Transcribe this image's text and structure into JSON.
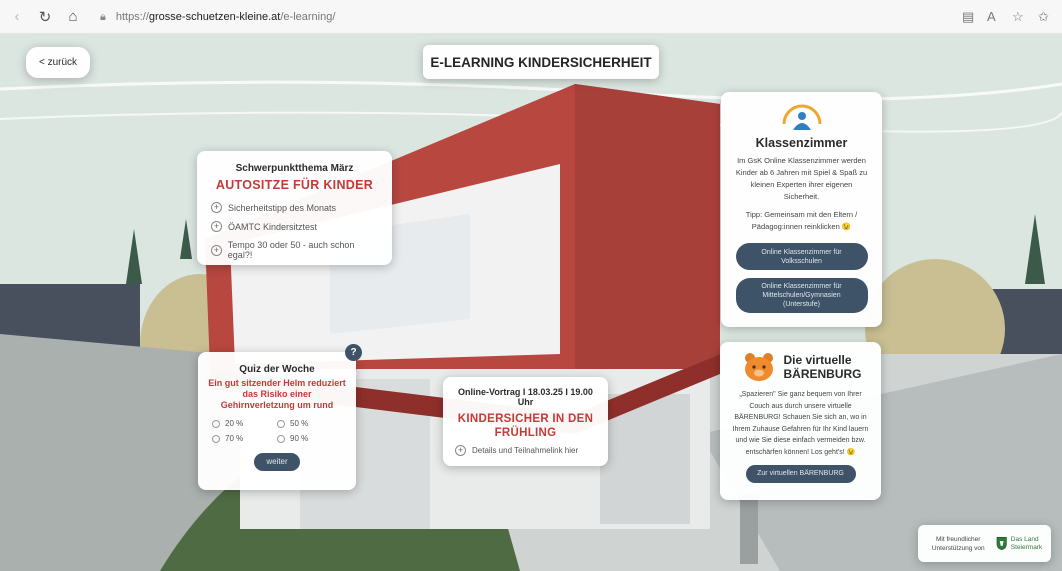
{
  "browser": {
    "url_prefix": "https://",
    "url_domain": "grosse-schuetzen-kleine.at",
    "url_path": "/e-learning/"
  },
  "header": {
    "back_label": "< zurück",
    "title": "E-LEARNING KINDERSICHERHEIT"
  },
  "focus_card": {
    "heading": "Schwerpunktthema März",
    "title": "AUTOSITZE FÜR KINDER",
    "links": [
      "Sicherheitstipp des Monats",
      "ÖAMTC Kindersitztest",
      "Tempo 30 oder 50 - auch schon egal?!"
    ]
  },
  "quiz_card": {
    "badge": "?",
    "heading": "Quiz der Woche",
    "question": "Ein gut sitzender Helm reduziert das Risiko einer Gehirnverletzung um rund",
    "options": [
      "20 %",
      "50 %",
      "70 %",
      "90 %"
    ],
    "button": "weiter"
  },
  "lecture_card": {
    "heading": "Online-Vortrag I 18.03.25 I 19.00 Uhr",
    "title": "KINDERSICHER IN DEN FRÜHLING",
    "link": "Details und Teilnahmelink hier"
  },
  "classroom_card": {
    "title": "Klassenzimmer",
    "text": "Im GsK Online Klassenzimmer werden Kinder ab 6 Jahren mit Spiel & Spaß zu kleinen Experten ihrer eigenen Sicherheit.",
    "tip": "Tipp: Gemeinsam mit den Eltern / Pädagog:innen reinklicken 😉",
    "button1": "Online Klassenzimmer für Volksschulen",
    "button2": "Online Klassenzimmer für Mittelschulen/Gymnasien (Unterstufe)"
  },
  "bear_card": {
    "title_line1": "Die virtuelle",
    "title_line2": "BÄRENBURG",
    "text": "„Spazieren\" Sie ganz bequem von Ihrer Couch aus durch unsere virtuelle BÄRENBURG! Schauen Sie sich an, wo in Ihrem Zuhause Gefahren für Ihr Kind lauern und wie Sie diese einfach vermeiden bzw. entschärfen können! Los geht's! 😉",
    "button": "Zur virtuellen BÄRENBURG"
  },
  "sponsor": {
    "text": "Mit freundlicher Unterstützung von",
    "logo_text": "Das Land Steiermark"
  }
}
